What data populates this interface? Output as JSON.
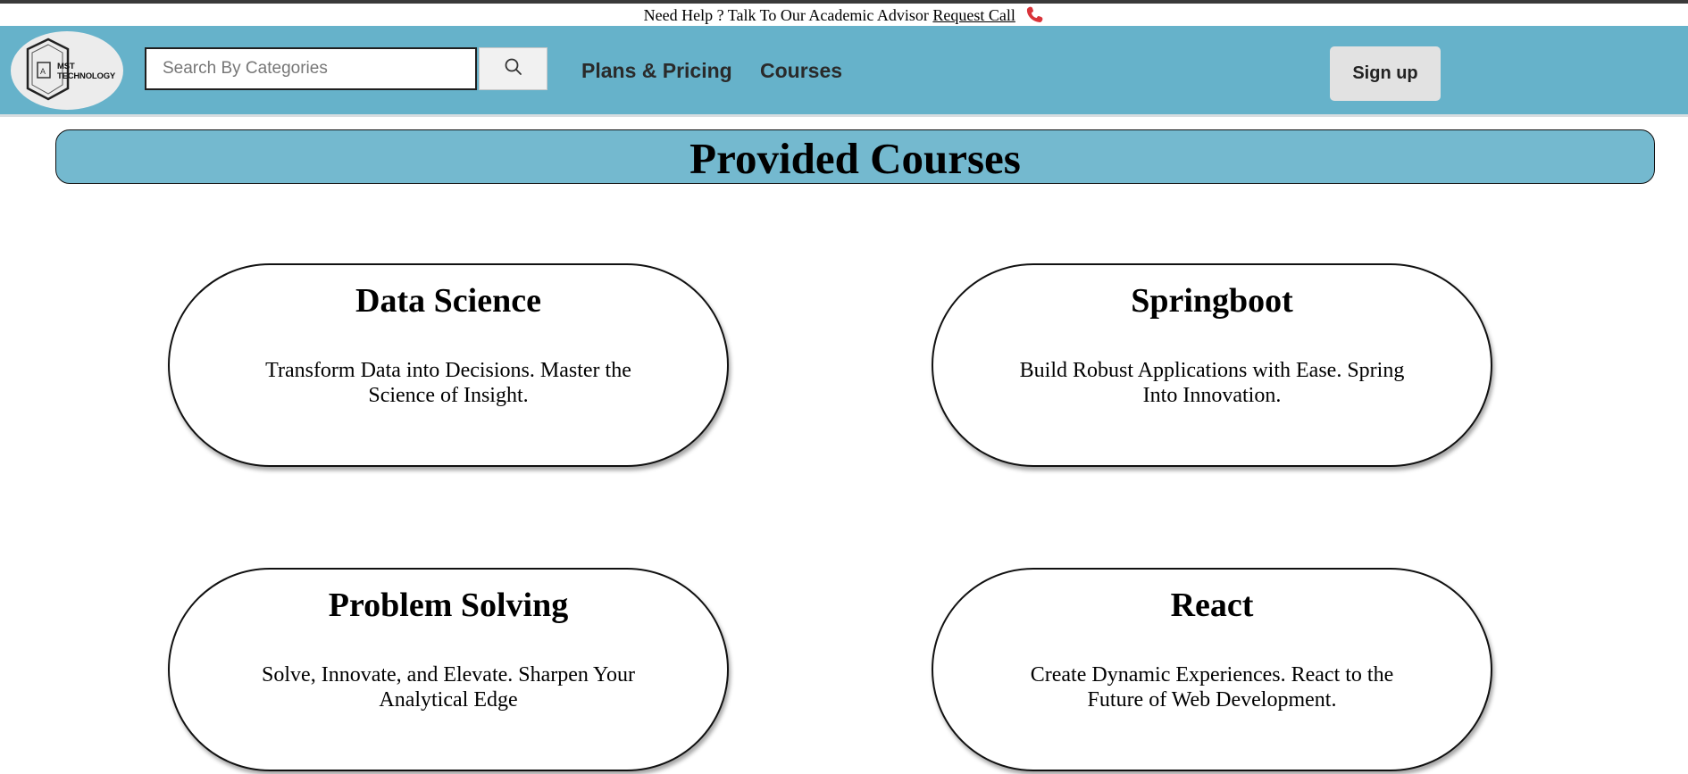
{
  "help_bar": {
    "text": "Need Help ? Talk To Our Academic Advisor",
    "link": "Request Call",
    "icon": "phone-icon",
    "icon_color": "#d9343a"
  },
  "navbar": {
    "background": "#66b2ca",
    "logo": {
      "line1": "MST",
      "line2": "TECHNOLOGY"
    },
    "search": {
      "placeholder": "Search By Categories",
      "value": "",
      "icon": "search-icon"
    },
    "links": [
      "Plans & Pricing",
      "Courses"
    ],
    "signup_label": "Sign up"
  },
  "banner": {
    "title": "Provided Courses",
    "background": "#74b9cf"
  },
  "courses": [
    {
      "title": "Data Science",
      "description": "Transform Data into Decisions. Master the Science of Insight."
    },
    {
      "title": "Springboot",
      "description": "Build Robust Applications with Ease. Spring Into Innovation."
    },
    {
      "title": "Problem Solving",
      "description": "Solve, Innovate, and Elevate. Sharpen Your Analytical Edge"
    },
    {
      "title": "React",
      "description": "Create Dynamic Experiences. React to the Future of Web Development."
    }
  ]
}
